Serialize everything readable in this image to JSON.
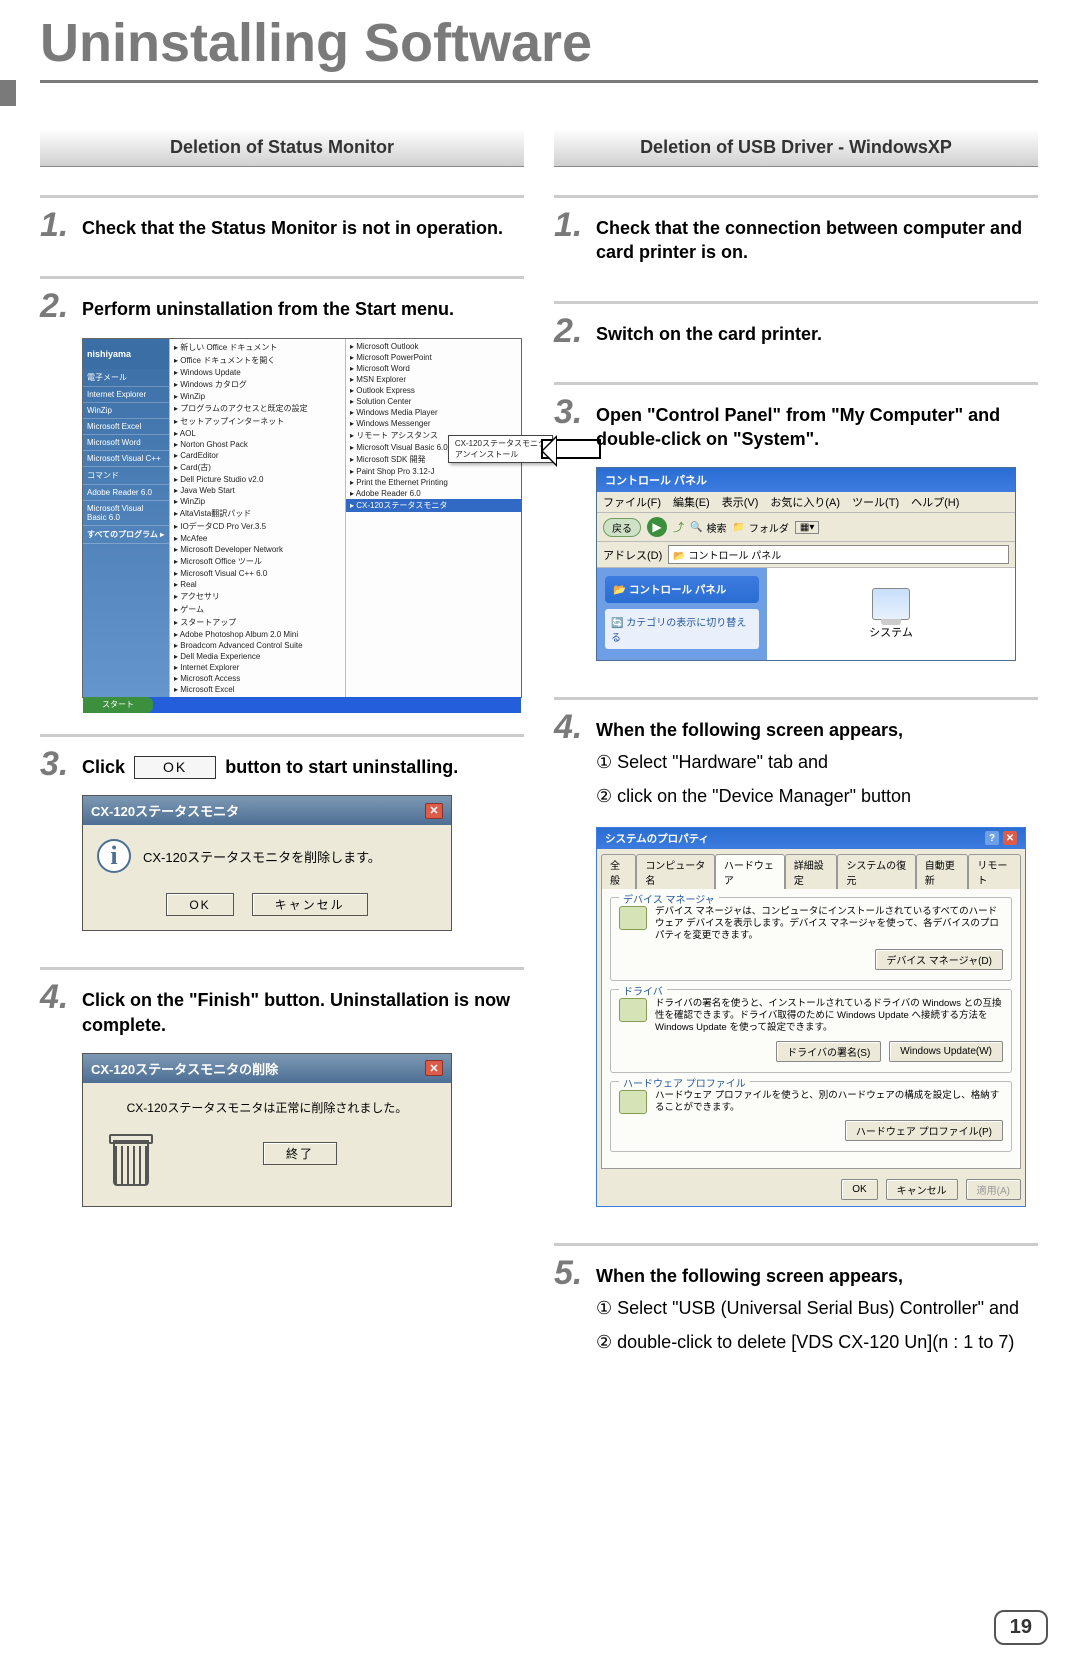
{
  "page_number": "19",
  "page_title": "Uninstalling Software",
  "left": {
    "section_header": "Deletion of Status Monitor",
    "steps": [
      {
        "num": "1.",
        "text": "Check that the Status Monitor is not in operation."
      },
      {
        "num": "2.",
        "text": "Perform uninstallation from the Start menu."
      },
      {
        "num": "3.",
        "text_before": "Click",
        "button": "OK",
        "text_after": "button to start uninstalling."
      },
      {
        "num": "4.",
        "text": "Click on the \"Finish\" button. Uninstallation is now complete."
      }
    ],
    "startmenu": {
      "user": "nishiyama",
      "left_items": [
        "電子メール",
        "Internet Explorer",
        "WinZip",
        "Microsoft Excel",
        "Microsoft Word",
        "Microsoft Visual C++",
        "コマンド",
        "Adobe Reader 6.0",
        "Microsoft Visual Basic 6.0"
      ],
      "all_programs": "すべてのプログラム",
      "col_a": [
        "新しい Office ドキュメント",
        "Office ドキュメントを開く",
        "Windows Update",
        "Windows カタログ",
        "WinZip",
        "プログラムのアクセスと既定の設定",
        "セットアップインターネット",
        "AOL",
        "Norton Ghost Pack",
        "CardEditor",
        "Card(古)",
        "Dell Picture Studio v2.0",
        "Java Web Start",
        "WinZip",
        "AltaVista翻訳パッド",
        "IOデータCD Pro Ver.3.5",
        "McAfee",
        "Microsoft Developer Network",
        "Microsoft Office ツール",
        "Microsoft Visual C++ 6.0",
        "Real",
        "アクセサリ",
        "ゲーム",
        "スタートアップ",
        "Adobe Photoshop Album 2.0 Mini",
        "Broadcom Advanced Control Suite",
        "Dell Media Experience",
        "Internet Explorer",
        "Microsoft Access",
        "Microsoft Excel"
      ],
      "col_b": [
        "Microsoft Outlook",
        "Microsoft PowerPoint",
        "Microsoft Word",
        "MSN Explorer",
        "Outlook Express",
        "Solution Center",
        "Windows Media Player",
        "Windows Messenger",
        "リモート アシスタンス",
        "Microsoft Visual Basic 6.0",
        "Microsoft SDK 開発",
        "Paint Shop Pro 3.12-J",
        "Print the Ethernet Printing",
        "Adobe Reader 6.0",
        "CX-120ステータスモニタ"
      ],
      "popup_items": [
        "CX-120ステータスモニタ",
        "アンインストール"
      ],
      "start_button": "スタート"
    },
    "dlg_confirm": {
      "title": "CX-120ステータスモニタ",
      "msg": "CX-120ステータスモニタを削除します。",
      "ok": "OK",
      "cancel": "キャンセル"
    },
    "dlg_done": {
      "title": "CX-120ステータスモニタの削除",
      "msg": "CX-120ステータスモニタは正常に削除されました。",
      "finish": "終了"
    }
  },
  "right": {
    "section_header": "Deletion of USB Driver - WindowsXP",
    "steps": [
      {
        "num": "1.",
        "text": "Check that the connection between computer and card printer is on."
      },
      {
        "num": "2.",
        "text": "Switch on the card printer."
      },
      {
        "num": "3.",
        "text": "Open \"Control Panel\" from \"My Computer\" and double-click on \"System\"."
      },
      {
        "num": "4.",
        "text": "When the following screen appears,",
        "sub": [
          "① Select \"Hardware\" tab and",
          "② click on the \"Device Manager\" button"
        ]
      },
      {
        "num": "5.",
        "text": "When the following screen appears,",
        "sub": [
          "① Select \"USB (Universal Serial Bus) Controller\" and",
          "② double-click to delete [VDS CX-120 Un](n : 1 to 7)"
        ]
      }
    ],
    "cpanel": {
      "title": "コントロール パネル",
      "menu": [
        "ファイル(F)",
        "編集(E)",
        "表示(V)",
        "お気に入り(A)",
        "ツール(T)",
        "ヘルプ(H)"
      ],
      "back": "戻る",
      "search": "検索",
      "folders": "フォルダ",
      "addr_label": "アドレス(D)",
      "addr_value": "コントロール パネル",
      "side_title": "コントロール パネル",
      "side_link": "カテゴリの表示に切り替える",
      "system_label": "システム"
    },
    "sysprop": {
      "title": "システムのプロパティ",
      "tabs": [
        "全般",
        "コンピュータ名",
        "ハードウェア",
        "詳細設定",
        "システムの復元",
        "自動更新",
        "リモート"
      ],
      "active_tab_index": 2,
      "grp_devmgr": {
        "title": "デバイス マネージャ",
        "desc": "デバイス マネージャは、コンピュータにインストールされているすべてのハードウェア デバイスを表示します。デバイス マネージャを使って、各デバイスのプロパティを変更できます。",
        "btn": "デバイス マネージャ(D)"
      },
      "grp_drv": {
        "title": "ドライバ",
        "desc": "ドライバの署名を使うと、インストールされているドライバの Windows との互換性を確認できます。ドライバ取得のために Windows Update へ接続する方法を Windows Update を使って設定できます。",
        "btn1": "ドライバの署名(S)",
        "btn2": "Windows Update(W)"
      },
      "grp_hw": {
        "title": "ハードウェア プロファイル",
        "desc": "ハードウェア プロファイルを使うと、別のハードウェアの構成を設定し、格納することができます。",
        "btn": "ハードウェア プロファイル(P)"
      },
      "footer": {
        "ok": "OK",
        "cancel": "キャンセル",
        "apply": "適用(A)"
      }
    }
  }
}
